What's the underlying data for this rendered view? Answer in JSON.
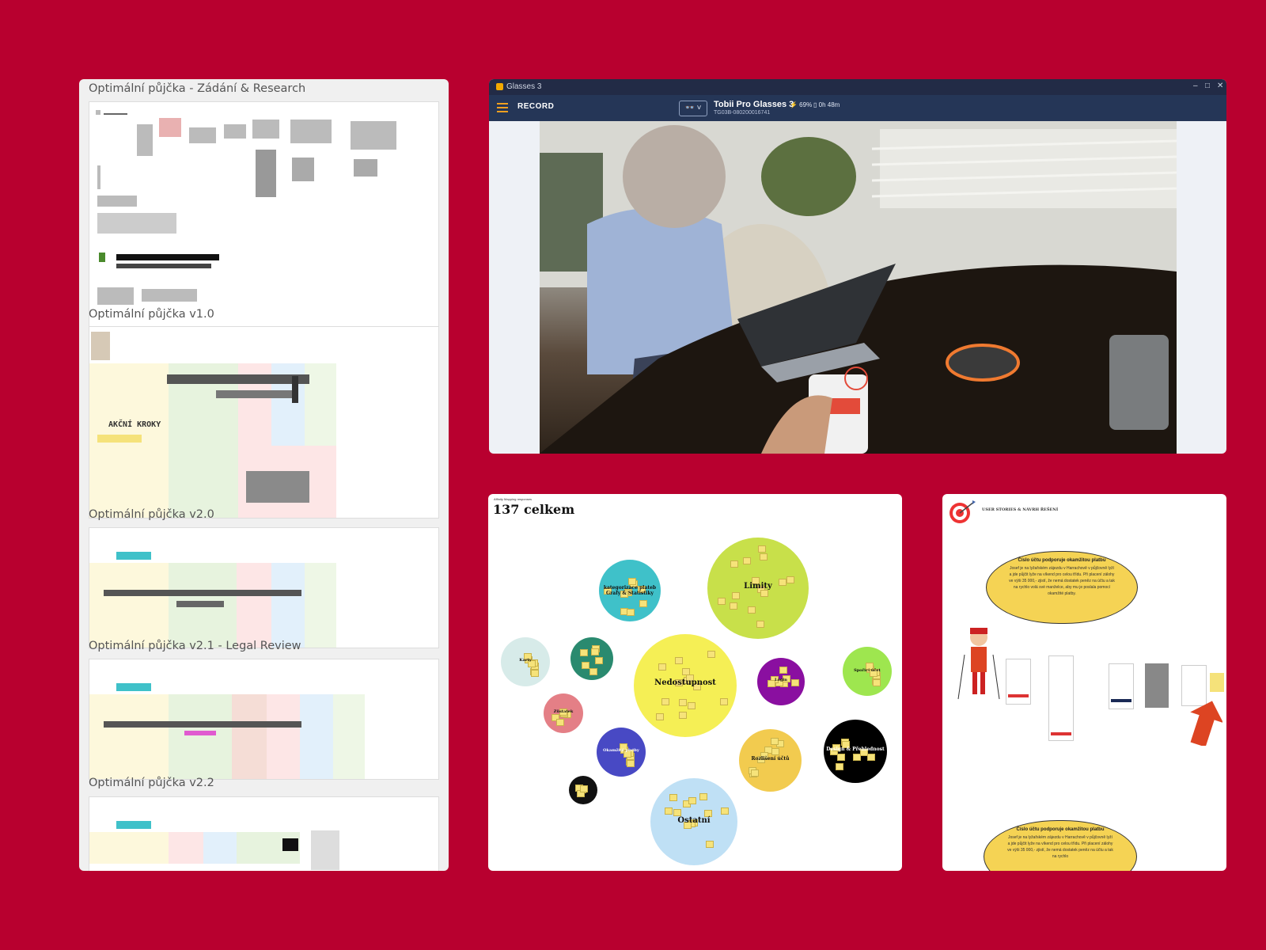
{
  "boards": [
    {
      "title": "Optimální půjčka - Zádání & Research"
    },
    {
      "title": "Optimální půjčka v1.0",
      "note": "AKČNÍ KROKY"
    },
    {
      "title": "Optimální půjčka v2.0"
    },
    {
      "title": "Optimální půjčka v2.1 - Legal Review"
    },
    {
      "title": "Optimální půjčka v2.2"
    }
  ],
  "glasses": {
    "window_title": "Glasses 3",
    "record_label": "RECORD",
    "device_button": "👓 ˅",
    "device_name": "Tobii Pro Glasses 3",
    "device_serial": "TG03B-080200016741",
    "battery": "⚡ 69%",
    "recording_time": "▯ 0h 48m",
    "window_controls": [
      "–",
      "□",
      "✕"
    ]
  },
  "affinity": {
    "subtitle": "Affinity Mapping responses",
    "title": "137 celkem",
    "clusters": [
      {
        "label": "Limity",
        "color": "#c8e04a"
      },
      {
        "label": "kategorizace plateb Grafy & Statistiky",
        "color": "#3fc1c9"
      },
      {
        "label": "Nedostupnost",
        "color": "#f5ef55"
      },
      {
        "label": "Karty",
        "color": "#d7ebe9"
      },
      {
        "label": "",
        "color": "#2a8a6f"
      },
      {
        "label": "Zůstatek",
        "color": "#e47f86"
      },
      {
        "label": "Okamžité platby",
        "color": "#4849c4"
      },
      {
        "label": "",
        "color": "#111111"
      },
      {
        "label": "Login",
        "color": "#8a0fa0"
      },
      {
        "label": "Spořicí účet",
        "color": "#9ee64f"
      },
      {
        "label": "Rozlišení účtů",
        "color": "#f2cb4f"
      },
      {
        "label": "Design & Přehlednost",
        "color": "#000000"
      },
      {
        "label": "Ostatní",
        "color": "#bfe0f5"
      }
    ]
  },
  "stories": {
    "title": "USER STORIES & NÁVRH ŘEŠENÍ",
    "cloud_heading": "Číslo účtu podporuje okamžitou platbu",
    "cloud_text": "Josef je na lyžařském zájezdu v Harrachově v půjčovně lyží a jde půjčit lyže na víkend pro celou třídu. Při placení zálohy ve výši 35 000,- zjistí, že nemá dostatek peněz na účtu a tak na rychlo volá své manželce, aby mu je poslala pomocí okamžité platby.",
    "cloud2_heading": "Číslo účtu podporuje okamžitou platbu",
    "cloud2_text": "Josef je na lyžařském zájezdu v Harrachově v půjčovně lyží a jde půjčit lyže na víkend pro celou třídu. Při placení zálohy ve výši 35 000,- zjistí, že nemá dostatek peněz na účtu a tak na rychlo"
  }
}
